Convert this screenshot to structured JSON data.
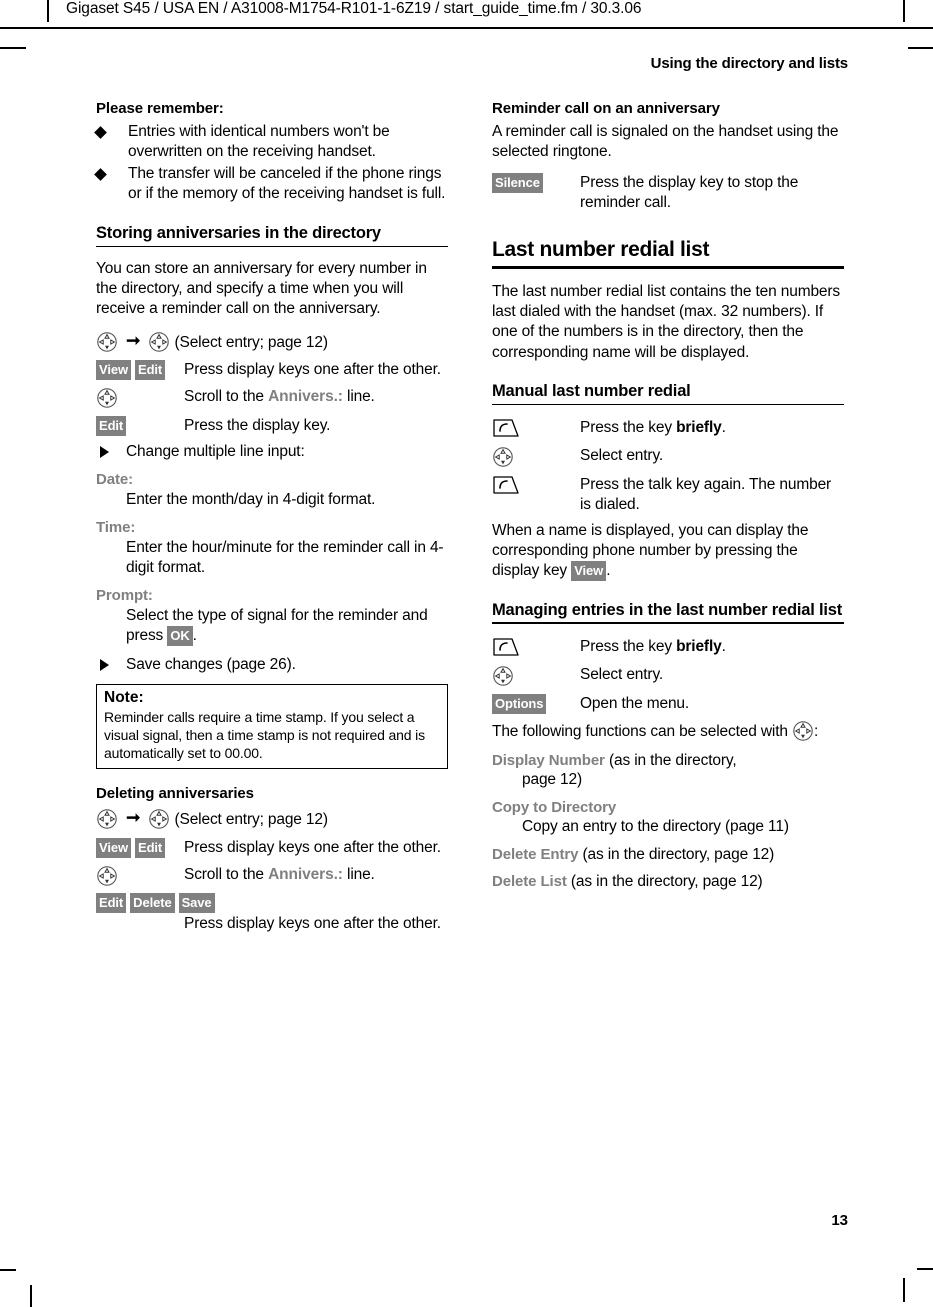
{
  "header": {
    "file_line": "Gigaset S45 / USA EN / A31008-M1754-R101-1-6Z19 / start_guide_time.fm / 30.3.06",
    "chapter_title": "Using the directory and lists",
    "page_number": "13"
  },
  "left_column": {
    "remember": {
      "title": "Please remember:",
      "bullets": [
        "Entries with identical numbers won't be overwritten on the receiving handset.",
        "The transfer will be canceled if the phone rings or if the memory of the receiving handset is full."
      ]
    },
    "storing": {
      "heading": "Storing anniversaries in the directory",
      "intro": "You can store an anniversary for every number in the directory, and specify a time when you will receive a reminder call on the anniversary.",
      "sequence_tail": "(Select entry; page 12)",
      "rows": [
        {
          "keys": [
            "View",
            "Edit"
          ],
          "desc": "Press display keys one after the other."
        },
        {
          "icon": "rocker",
          "desc_pre": "Scroll to the ",
          "desc_literal": "Annivers.:",
          "desc_post": " line."
        },
        {
          "keys": [
            "Edit"
          ],
          "desc": "Press the display key."
        }
      ],
      "step_change": "Change multiple line input:",
      "fields": [
        {
          "term": "Date:",
          "desc": "Enter the month/day in 4-digit format."
        },
        {
          "term": "Time:",
          "desc": "Enter the hour/minute for the reminder call in 4-digit format."
        },
        {
          "term": "Prompt:",
          "desc_pre": "Select the type of signal for the reminder and press ",
          "desc_key": "OK",
          "desc_post": "."
        }
      ],
      "step_save": "Save changes (page 26)."
    },
    "note": {
      "title": "Note:",
      "text": "Reminder calls require a time stamp. If you select a visual signal, then a time stamp is not required and is automatically set to 00.00."
    },
    "deleting": {
      "heading": "Deleting anniversaries",
      "sequence_tail": "(Select entry; page 12)",
      "rows": [
        {
          "keys": [
            "View",
            "Edit"
          ],
          "desc": "Press display keys one after the other."
        },
        {
          "icon": "rocker",
          "desc_pre": "Scroll to the ",
          "desc_literal": "Annivers.:",
          "desc_post": " line."
        },
        {
          "keys": [
            "Edit",
            "Delete",
            "Save"
          ],
          "desc": "Press display keys one after the other."
        }
      ]
    }
  },
  "right_column": {
    "reminder": {
      "heading": "Reminder call on an anniversary",
      "intro": "A reminder call is signaled on the handset using the selected ringtone.",
      "row": {
        "key": "Silence",
        "desc": "Press the display key to stop the reminder call."
      }
    },
    "redial": {
      "heading": "Last number redial list",
      "intro": "The last number redial list contains the ten numbers last dialed with the handset (max. 32 numbers). If one of the numbers is in the directory, then the corresponding name will be displayed."
    },
    "manual_redial": {
      "heading": "Manual last number redial",
      "rows": [
        {
          "icon": "talk-key",
          "desc_pre": "Press the key ",
          "desc_bold": "briefly",
          "desc_post": "."
        },
        {
          "icon": "rocker",
          "desc": "Select entry."
        },
        {
          "icon": "talk-key",
          "desc": "Press the talk key again. The number is dialed."
        }
      ],
      "outro_pre": "When a name is displayed, you can display the corresponding phone number by pressing the display key ",
      "outro_key": "View",
      "outro_post": "."
    },
    "managing": {
      "heading": "Managing entries in the last number redial list",
      "rows": [
        {
          "icon": "talk-key",
          "desc_pre": "Press the key ",
          "desc_bold": "briefly",
          "desc_post": "."
        },
        {
          "icon": "rocker",
          "desc": "Select entry."
        },
        {
          "key": "Options",
          "desc": "Open the menu."
        }
      ],
      "functions_intro_pre": "The following functions can be selected with ",
      "functions_intro_post": ":",
      "functions": [
        {
          "name": "Display Number",
          "tail": " (as in the directory,",
          "desc": "page 12)"
        },
        {
          "name": "Copy to Directory",
          "tail": "",
          "desc": "Copy an entry to the directory (page 11)"
        },
        {
          "name": "Delete Entry",
          "tail": " (as in the directory, page 12)",
          "desc": ""
        },
        {
          "name": "Delete List",
          "tail": " (as in the directory, page 12)",
          "desc": ""
        }
      ]
    }
  },
  "colors": {
    "chip_background": "#808080",
    "chip_text": "#ffffff",
    "literal_gray": "#808080",
    "rule": "#000000"
  }
}
